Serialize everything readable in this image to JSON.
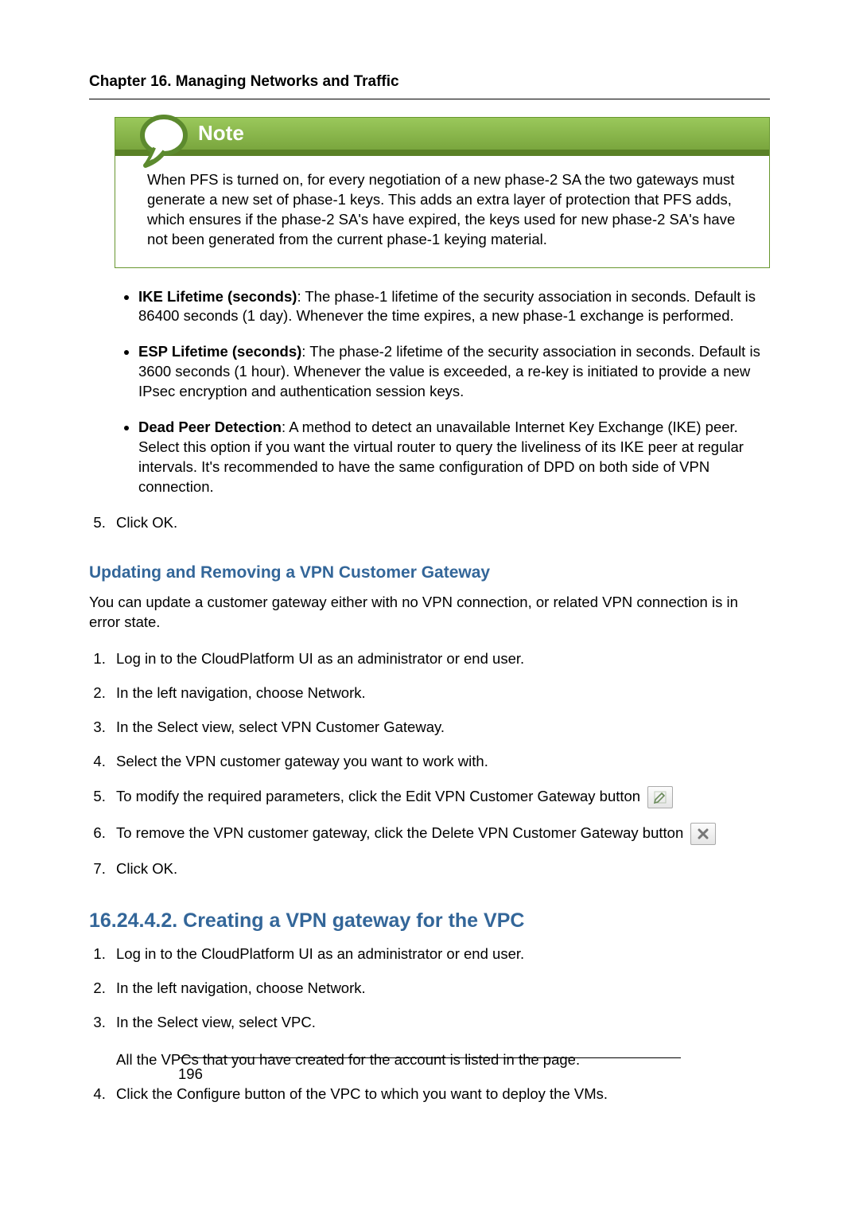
{
  "header": {
    "chapter": "Chapter 16. Managing Networks and Traffic"
  },
  "note": {
    "label": "Note",
    "body": "When PFS is turned on, for every negotiation of a new phase-2 SA the two gateways must generate a new set of phase-1 keys. This adds an extra layer of protection that PFS adds, which ensures if the phase-2 SA's have expired, the keys used for new phase-2 SA's have not been generated from the current phase-1 keying material."
  },
  "bullets": {
    "ike_term": "IKE Lifetime (seconds)",
    "ike_text": ": The phase-1 lifetime of the security association in seconds. Default is 86400 seconds (1 day). Whenever the time expires, a new phase-1 exchange is performed.",
    "esp_term": "ESP Lifetime (seconds)",
    "esp_text": ": The phase-2 lifetime of the security association in seconds. Default is 3600 seconds (1 hour). Whenever the value is exceeded, a re-key is initiated to provide a new IPsec encryption and authentication session keys.",
    "dpd_term": "Dead Peer Detection",
    "dpd_text": ": A method to detect an unavailable Internet Key Exchange (IKE) peer. Select this option if you want the virtual router to query the liveliness of its IKE peer at regular intervals. It's recommended to have the same configuration of DPD on both side of VPN connection."
  },
  "steps_a": {
    "s5": "Click OK."
  },
  "section_update": {
    "heading": "Updating and Removing a VPN Customer Gateway",
    "intro": "You can update a customer gateway either with no VPN connection, or related VPN connection is in error state.",
    "steps": {
      "s1": "Log in to the CloudPlatform UI as an administrator or end user.",
      "s2": "In the left navigation, choose Network.",
      "s3": "In the Select view, select VPN Customer Gateway.",
      "s4": "Select the VPN customer gateway you want to work with.",
      "s5": "To modify the required parameters, click the Edit VPN Customer Gateway button",
      "s6": "To remove the VPN customer gateway, click the Delete VPN Customer Gateway button",
      "s7": "Click OK."
    }
  },
  "section_vpc": {
    "heading": "16.24.4.2. Creating a VPN gateway for the VPC",
    "steps": {
      "s1": "Log in to the CloudPlatform UI as an administrator or end user.",
      "s2": "In the left navigation, choose Network.",
      "s3": "In the Select view, select VPC.",
      "s3b": "All the VPCs that you have created for the account is listed in the page.",
      "s4": "Click the Configure button of the VPC to which you want to deploy the VMs."
    }
  },
  "footer": {
    "page_number": "196"
  },
  "icons": {
    "note_icon_name": "speech-bubble-icon",
    "edit_icon_name": "edit-icon",
    "delete_icon_name": "delete-icon"
  }
}
